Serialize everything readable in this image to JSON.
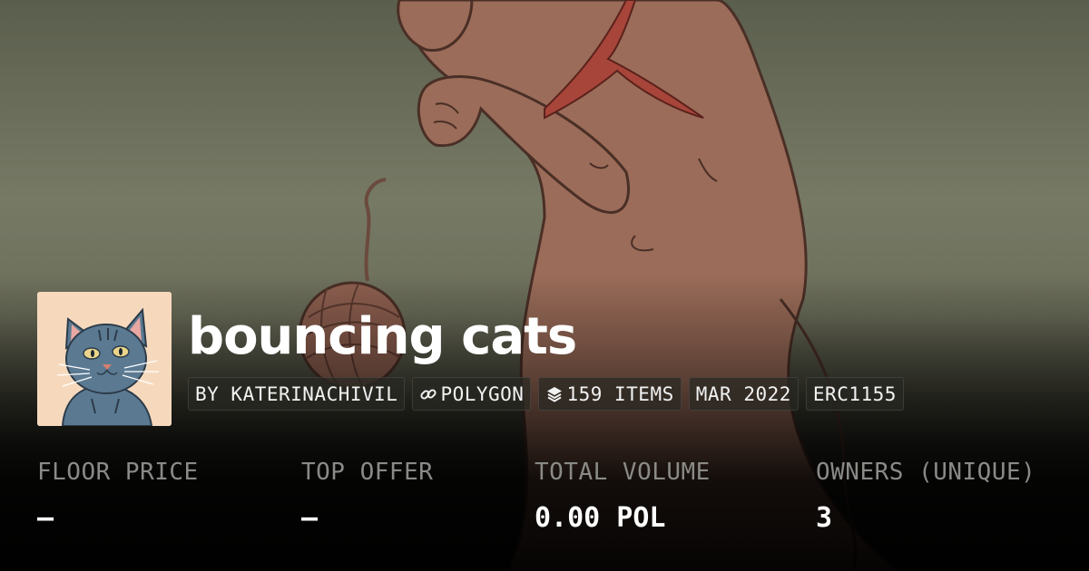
{
  "collection": {
    "name": "bouncing cats"
  },
  "chips": {
    "creator": "BY KATERINACHIVIL",
    "chain": "POLYGON",
    "items": "159 ITEMS",
    "created": "MAR 2022",
    "standard": "ERC1155"
  },
  "icons": {
    "chain": "link-icon",
    "items": "layers-icon"
  },
  "stats": [
    {
      "label": "FLOOR PRICE",
      "value": "–"
    },
    {
      "label": "TOP OFFER",
      "value": "–"
    },
    {
      "label": "TOTAL VOLUME",
      "value": "0.00 POL"
    },
    {
      "label": "OWNERS (UNIQUE)",
      "value": "3"
    }
  ],
  "colors": {
    "background_top": "#5a5e4c",
    "cat_body": "#9a6a58",
    "scarf": "#a8453a",
    "avatar_bg": "#f6d9bd",
    "avatar_cat": "#5b7a92",
    "label_gray": "#8a8a86"
  }
}
